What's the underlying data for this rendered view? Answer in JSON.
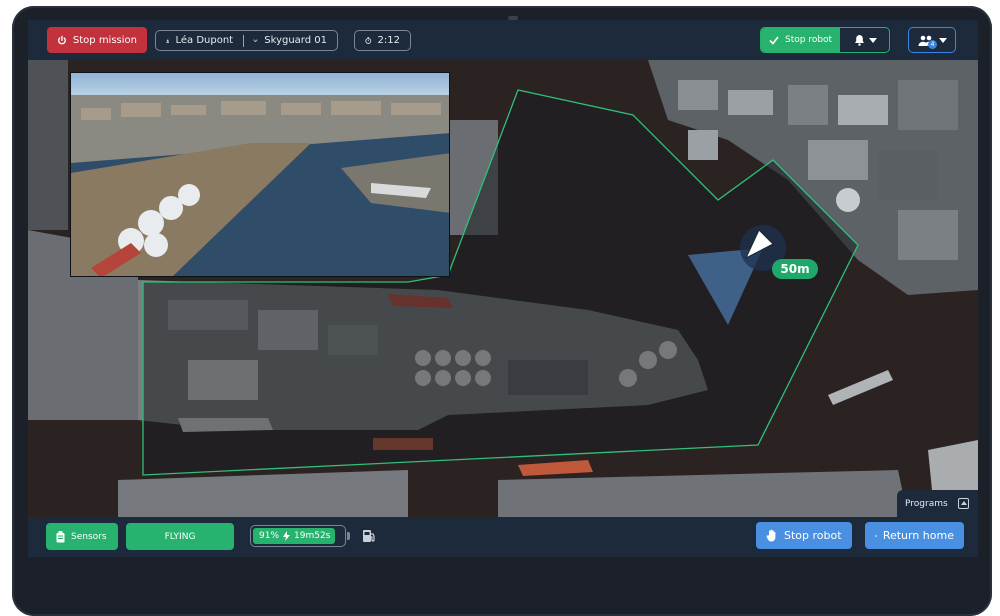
{
  "header": {
    "stop_mission_label": "Stop mission",
    "operator_name": "Léa Dupont",
    "robot_name": "Skyguard 01",
    "mission_timer": "2:12",
    "stop_robot_label": "Stop robot",
    "team_badge_count": "4"
  },
  "map": {
    "distance_label": "50m",
    "programs_label": "Programs"
  },
  "footer": {
    "sensors_label": "Sensors",
    "status_label": "FLYING",
    "battery_percent_label": "91%",
    "battery_percent": 91,
    "battery_time": "19m52s",
    "stop_robot_label": "Stop robot",
    "return_home_label": "Return home"
  },
  "colors": {
    "danger": "#c2313c",
    "success": "#27b36f",
    "primary": "#4a90e2",
    "bar_bg": "#1c2a3b",
    "geofence": "#2fc07a"
  },
  "icons": {
    "stop_mission": "power-icon",
    "operator": "user-icon",
    "robot": "drone-icon",
    "timer": "stopwatch-icon",
    "stop_robot": "check-icon",
    "notifications": "bell-icon",
    "team": "users-icon",
    "sensors": "sensor-icon",
    "battery": "lightning-icon",
    "fuel": "fuel-icon",
    "stop_hand": "hand-icon",
    "home": "home-icon",
    "programs": "chevron-up-box-icon"
  }
}
